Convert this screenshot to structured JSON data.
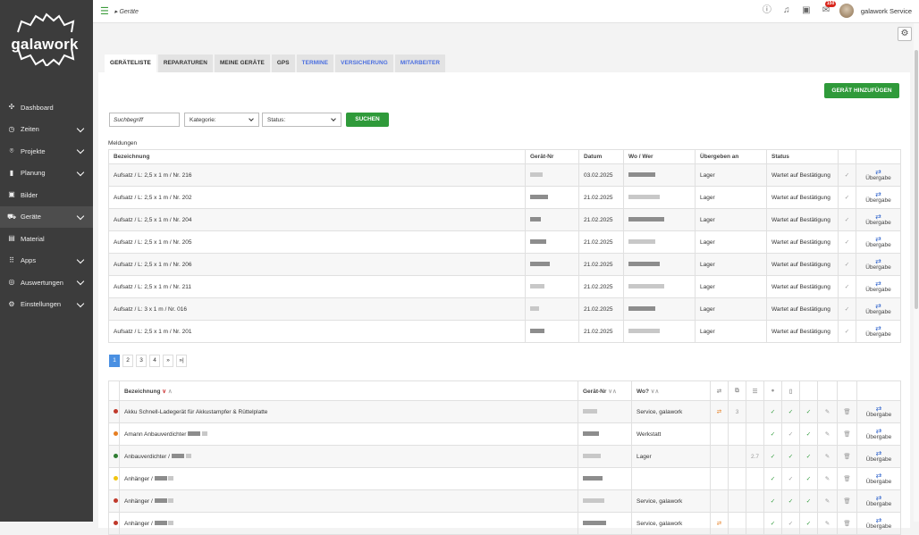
{
  "app": {
    "logo_text": "galawork",
    "breadcrumb": "Geräte",
    "username": "galawork Service",
    "notification_badge": "150"
  },
  "sidebar": {
    "items": [
      {
        "label": "Dashboard",
        "icon": "dashboard-icon",
        "chev": false
      },
      {
        "label": "Zeiten",
        "icon": "clock-icon",
        "chev": true
      },
      {
        "label": "Projekte",
        "icon": "location-pin-icon",
        "chev": true
      },
      {
        "label": "Planung",
        "icon": "bar-chart-icon",
        "chev": true
      },
      {
        "label": "Bilder",
        "icon": "image-icon",
        "chev": false
      },
      {
        "label": "Geräte",
        "icon": "car-icon",
        "chev": true,
        "active": true
      },
      {
        "label": "Material",
        "icon": "material-icon",
        "chev": false
      },
      {
        "label": "Apps",
        "icon": "apps-grid-icon",
        "chev": true
      },
      {
        "label": "Auswertungen",
        "icon": "analytics-icon",
        "chev": true
      },
      {
        "label": "Einstellungen",
        "icon": "settings-icon",
        "chev": true
      }
    ]
  },
  "tabs": [
    {
      "label": "GERÄTELISTE",
      "active": true,
      "blue": false
    },
    {
      "label": "REPARATUREN",
      "active": false,
      "blue": false
    },
    {
      "label": "MEINE GERÄTE",
      "active": false,
      "blue": false
    },
    {
      "label": "GPS",
      "active": false,
      "blue": false
    },
    {
      "label": "TERMINE",
      "active": false,
      "blue": true
    },
    {
      "label": "VERSICHERUNG",
      "active": false,
      "blue": true
    },
    {
      "label": "MITARBEITER",
      "active": false,
      "blue": true
    }
  ],
  "toolbar": {
    "add_button": "GERÄT HINZUFÜGEN",
    "search_placeholder": "Suchbegriff",
    "kategorie": "Kategorie:",
    "status": "Status:",
    "search_button": "SUCHEN"
  },
  "meldungen": {
    "label": "Meldungen",
    "headers": [
      "Bezeichnung",
      "Gerät-Nr",
      "Datum",
      "Wo / Wer",
      "Übergeben an",
      "Status",
      "",
      ""
    ],
    "action_label": "Übergabe",
    "rows": [
      {
        "bez": "Aufsatz / L: 2,5 x 1 m / Nr. 216",
        "datum": "03.02.2025",
        "an": "Lager",
        "status": "Wartet auf Bestätigung"
      },
      {
        "bez": "Aufsatz / L: 2,5 x 1 m / Nr. 202",
        "datum": "21.02.2025",
        "an": "Lager",
        "status": "Wartet auf Bestätigung"
      },
      {
        "bez": "Aufsatz / L: 2,5 x 1 m / Nr. 204",
        "datum": "21.02.2025",
        "an": "Lager",
        "status": "Wartet auf Bestätigung"
      },
      {
        "bez": "Aufsatz / L: 2,5 x 1 m / Nr. 205",
        "datum": "21.02.2025",
        "an": "Lager",
        "status": "Wartet auf Bestätigung"
      },
      {
        "bez": "Aufsatz / L: 2,5 x 1 m / Nr. 206",
        "datum": "21.02.2025",
        "an": "Lager",
        "status": "Wartet auf Bestätigung"
      },
      {
        "bez": "Aufsatz / L: 2,5 x 1 m / Nr. 211",
        "datum": "21.02.2025",
        "an": "Lager",
        "status": "Wartet auf Bestätigung"
      },
      {
        "bez": "Aufsatz / L: 3 x 1 m / Nr. 016",
        "datum": "21.02.2025",
        "an": "Lager",
        "status": "Wartet auf Bestätigung"
      },
      {
        "bez": "Aufsatz / L: 2,5 x 1 m / Nr. 201",
        "datum": "21.02.2025",
        "an": "Lager",
        "status": "Wartet auf Bestätigung"
      }
    ]
  },
  "pager": [
    "1",
    "2",
    "3",
    "4",
    "»",
    "»|"
  ],
  "devices": {
    "headers": {
      "bez": "Bezeichnung",
      "nr": "Gerät-Nr",
      "wo": "Wo?"
    },
    "action_label": "Übergabe",
    "rows": [
      {
        "dot": "#c0392b",
        "bez": "Akku Schnell-Ladegerät für Akkustampfer & Rüttelplatte",
        "wo": "Service, galawork",
        "sw": true,
        "n": "3",
        "v": ""
      },
      {
        "dot": "#e67e22",
        "bez": "Amann Anbauverdichter",
        "wo": "Werkstatt",
        "sw": false,
        "n": "",
        "v": ""
      },
      {
        "dot": "#2e7d32",
        "bez": "Anbauverdichter /",
        "wo": "Lager",
        "sw": false,
        "n": "",
        "v": "2.7"
      },
      {
        "dot": "#f1c40f",
        "bez": "Anhänger /",
        "wo": "",
        "sw": false,
        "n": "",
        "v": ""
      },
      {
        "dot": "#c0392b",
        "bez": "Anhänger /",
        "wo": "Service, galawork",
        "sw": false,
        "n": "",
        "v": ""
      },
      {
        "dot": "#c0392b",
        "bez": "Anhänger /",
        "wo": "Service, galawork",
        "sw": true,
        "n": "",
        "v": ""
      }
    ]
  }
}
